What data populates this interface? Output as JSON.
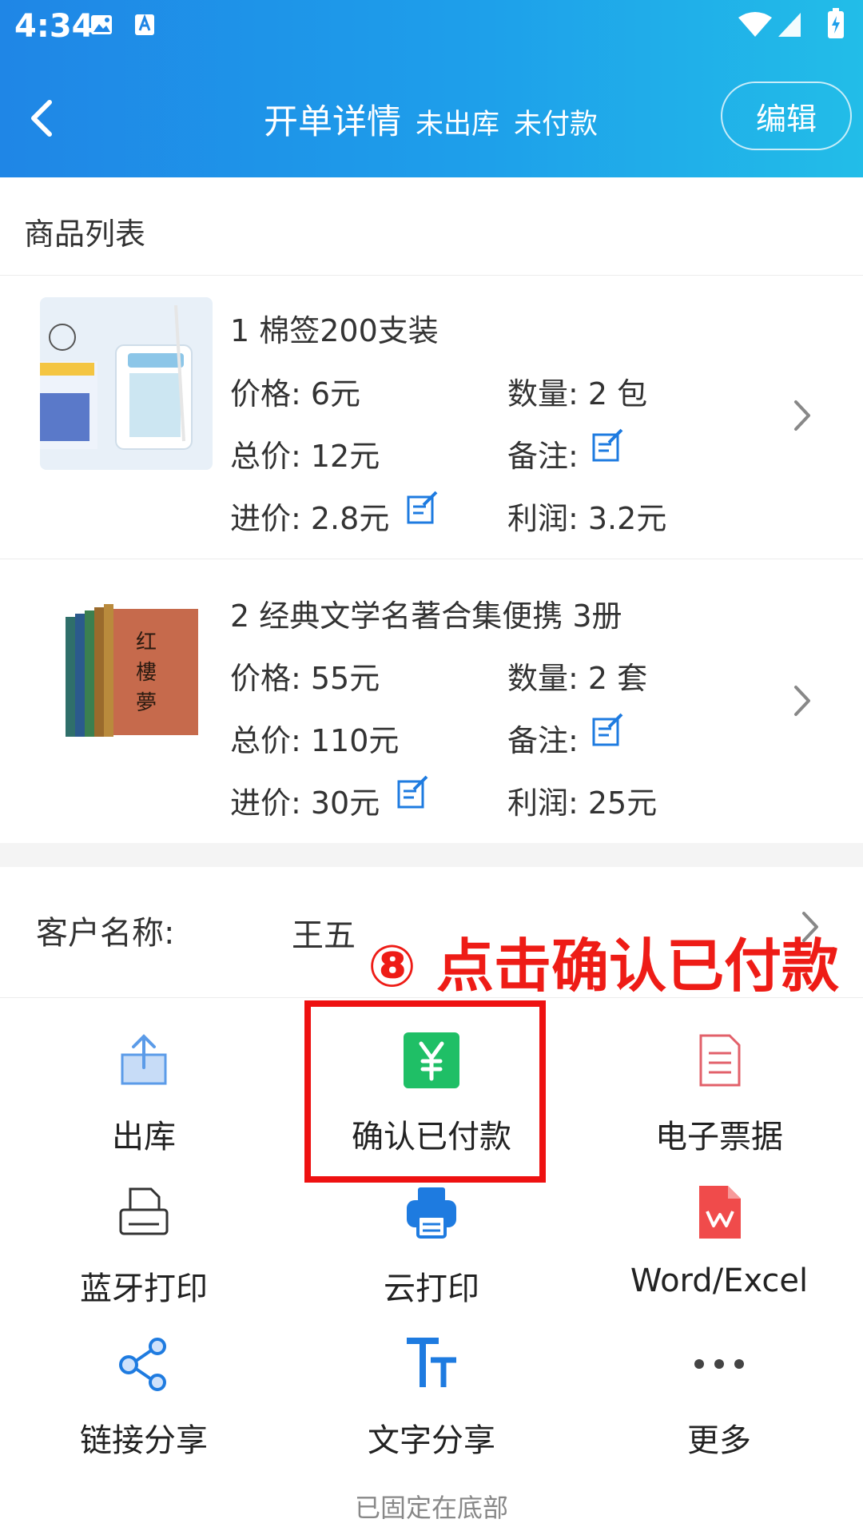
{
  "status_bar": {
    "time": "4:34"
  },
  "header": {
    "title": "开单详情",
    "status_outbound": "未出库",
    "status_payment": "未付款",
    "edit_label": "编辑"
  },
  "goods": {
    "section_title": "商品列表",
    "items": [
      {
        "name": "1 棉签200支装",
        "price": "价格: 6元",
        "quantity": "数量: 2 包",
        "total": "总价: 12元",
        "note": "备注:",
        "cost": "进价: 2.8元",
        "profit": "利润: 3.2元"
      },
      {
        "name": "2 经典文学名著合集便携 3册",
        "price": "价格: 55元",
        "quantity": "数量: 2 套",
        "total": "总价: 110元",
        "note": "备注:",
        "cost": "进价: 30元",
        "profit": "利润: 25元"
      }
    ]
  },
  "customer": {
    "label": "客户名称:",
    "value": "王五"
  },
  "annotation": "⑧ 点击确认已付款",
  "actions": [
    {
      "label": "出库",
      "icon": "share-upload-icon"
    },
    {
      "label": "确认已付款",
      "icon": "yuan-payment-icon"
    },
    {
      "label": "电子票据",
      "icon": "document-icon"
    },
    {
      "label": "蓝牙打印",
      "icon": "printer-outline-icon"
    },
    {
      "label": "云打印",
      "icon": "cloud-printer-icon"
    },
    {
      "label": "Word/Excel",
      "icon": "wps-file-icon"
    },
    {
      "label": "链接分享",
      "icon": "share-nodes-icon"
    },
    {
      "label": "文字分享",
      "icon": "text-tt-icon"
    },
    {
      "label": "更多",
      "icon": "more-dots-icon"
    }
  ],
  "pinned_note": "已固定在底部",
  "colors": {
    "header_start": "#1f86e6",
    "header_end": "#22bde8",
    "accent_blue": "#1e7be0",
    "annotation_red": "#ee1c16",
    "payment_green": "#1fbf66"
  }
}
